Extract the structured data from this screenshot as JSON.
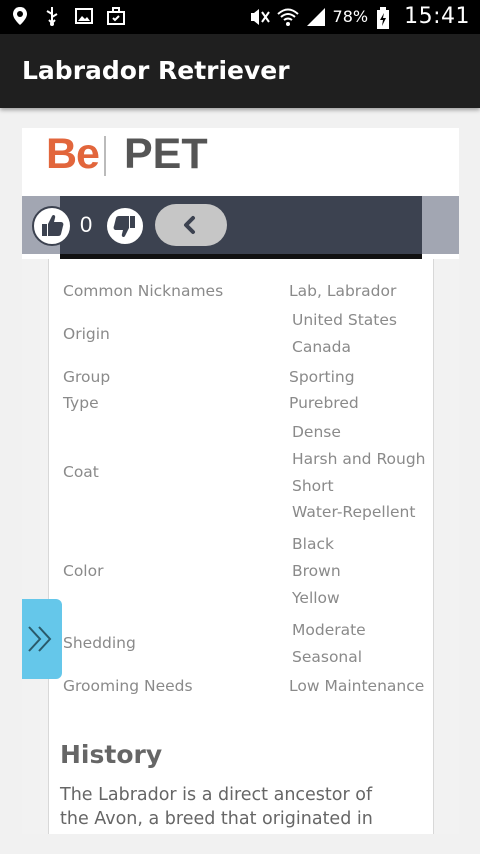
{
  "status_bar": {
    "battery_percent": "78%",
    "time": "15:41",
    "icons_left": [
      "location-icon",
      "usb-icon",
      "image-icon",
      "briefcase-icon"
    ],
    "icons_right": [
      "mute-icon",
      "wifi-icon",
      "signal-icon",
      "battery-icon"
    ]
  },
  "app_bar": {
    "title": "Labrador Retriever"
  },
  "logo": {
    "part1": "Be",
    "part2": "PET",
    "part1_color": "#e2663c",
    "part2_color": "#555555"
  },
  "vote": {
    "count": "0"
  },
  "details": [
    {
      "label": "Common Nicknames",
      "values": [
        "Lab, Labrador"
      ]
    },
    {
      "label": "Origin",
      "values": [
        "United States",
        "Canada"
      ]
    },
    {
      "label": "Group",
      "values": [
        "Sporting"
      ]
    },
    {
      "label": "Type",
      "values": [
        "Purebred"
      ]
    },
    {
      "label": "Coat",
      "values": [
        "Dense",
        "Harsh and Rough",
        "Short",
        "Water-Repellent"
      ]
    },
    {
      "label": "Color",
      "values": [
        "Black",
        "Brown",
        "Yellow"
      ]
    },
    {
      "label": "Shedding",
      "values": [
        "Moderate",
        "Seasonal"
      ]
    },
    {
      "label": "Grooming Needs",
      "values": [
        "Low Maintenance"
      ]
    }
  ],
  "history": {
    "title": "History",
    "text_line1": "The Labrador is a direct ancestor of",
    "text_line2": "the Avon, a breed that originated in"
  },
  "colors": {
    "accent_tab": "#65c7ea",
    "vote_band": "#3c4250"
  }
}
